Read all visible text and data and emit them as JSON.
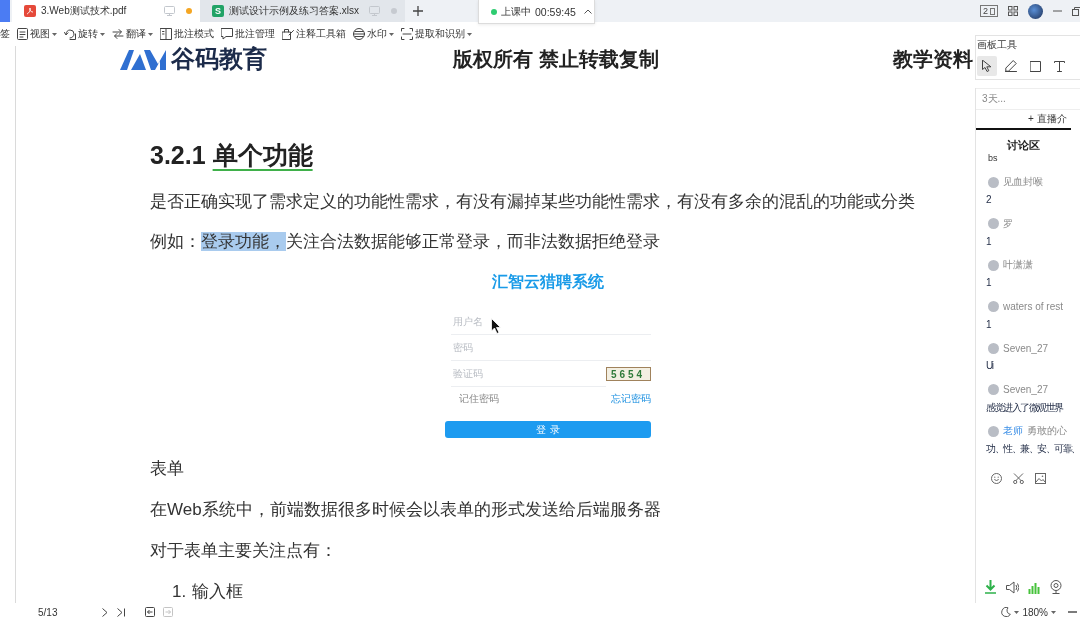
{
  "tabs": [
    {
      "title": "3.Web测试技术.pdf",
      "kind": "pdf",
      "selected": true,
      "modified": true
    },
    {
      "title": "测试设计示例及练习答案.xlsx",
      "kind": "sheet",
      "icon_text": "S",
      "selected": false,
      "modified": false
    }
  ],
  "class_timer": {
    "status": "上课中",
    "time": "00:59:45"
  },
  "window_controls": {
    "screen_count": "2"
  },
  "toolbar": [
    {
      "label": "签",
      "dropdown": false
    },
    {
      "label": "视图",
      "dropdown": true
    },
    {
      "label": "旋转",
      "dropdown": true
    },
    {
      "label": "翻译",
      "dropdown": true
    },
    {
      "label": "批注模式",
      "dropdown": false
    },
    {
      "label": "批注管理",
      "dropdown": false
    },
    {
      "label": "注释工具箱",
      "dropdown": false
    },
    {
      "label": "水印",
      "dropdown": true
    },
    {
      "label": "提取和识别",
      "dropdown": true
    }
  ],
  "document": {
    "header": {
      "brand": "谷码教育",
      "notice": "版权所有 禁止转载复制",
      "label": "教学资料"
    },
    "heading": {
      "number": "3.2.1",
      "title": "单个功能"
    },
    "intro": "是否正确实现了需求定义的功能性需求，有没有漏掉某些功能性需求，有没有多余的混乱的功能或分类",
    "example": {
      "before": "例如：",
      "highlight": "登录功能，",
      "after": "关注合法数据能够正常登录，而非法数据拒绝登录"
    },
    "login_figure": {
      "title": "汇智云猎聘系统",
      "fields": [
        {
          "placeholder": "用户名"
        },
        {
          "placeholder": "密码"
        },
        {
          "placeholder": "验证码",
          "captcha": "5654"
        }
      ],
      "remember": "记住密码",
      "forgot": "忘记密码",
      "submit": "登录"
    },
    "section": "表单",
    "paragraphs": [
      "在Web系统中，前端数据很多时候会以表单的形式发送给后端服务器",
      "对于表单主要关注点有："
    ],
    "list": [
      {
        "number": "1.",
        "text": "输入框"
      }
    ]
  },
  "side_panel": {
    "whiteboard_title": "画板工具",
    "tools": [
      {
        "selected": true
      },
      {
        "selected": false
      },
      {
        "selected": false
      },
      {
        "selected": false
      }
    ],
    "course": "3天...",
    "intro_link": "+ 直播介",
    "tab": "讨论区",
    "messages": [
      {
        "text": "bs"
      },
      {
        "author": "见血封喉",
        "text": "2"
      },
      {
        "author": "罗",
        "text": "1"
      },
      {
        "author": "叶潇潇",
        "text": "1"
      },
      {
        "author": "waters of rest",
        "text": "1"
      },
      {
        "author": "Seven_27",
        "text": "Ui"
      },
      {
        "author": "Seven_27",
        "text": "感觉进入了微观世界"
      },
      {
        "author": "勇敢的心",
        "badge": "老师",
        "text": "功、性、兼、安、可靠、"
      }
    ]
  },
  "status_bar": {
    "page": "5/13",
    "history": [
      {
        "disabled": false
      },
      {
        "disabled": true
      }
    ],
    "zoom": "180%"
  }
}
